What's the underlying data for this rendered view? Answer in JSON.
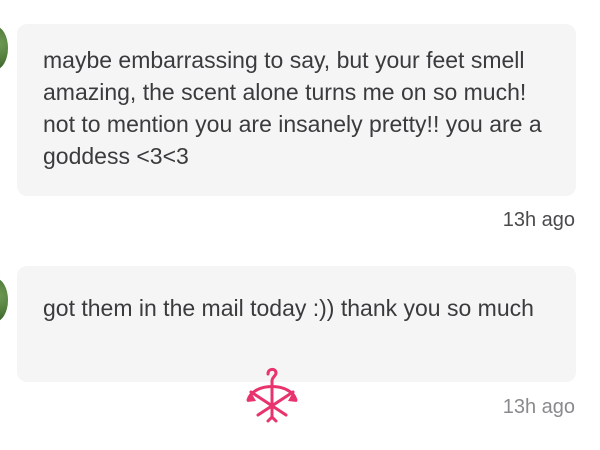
{
  "messages": [
    {
      "text": "maybe embarrassing to say, but your feet smell amazing, the scent alone turns me on so much! not to mention you are insanely pretty!! you are a goddess <3<3",
      "time": "13h ago"
    },
    {
      "text": "got them in the mail today :)) thank you so much",
      "time": "13h ago"
    }
  ],
  "colors": {
    "bubble": "#f5f5f6",
    "text": "#3b3b3d",
    "logo": "#e8336d"
  },
  "icons": {
    "watermark": "hanger-bow-logo"
  }
}
